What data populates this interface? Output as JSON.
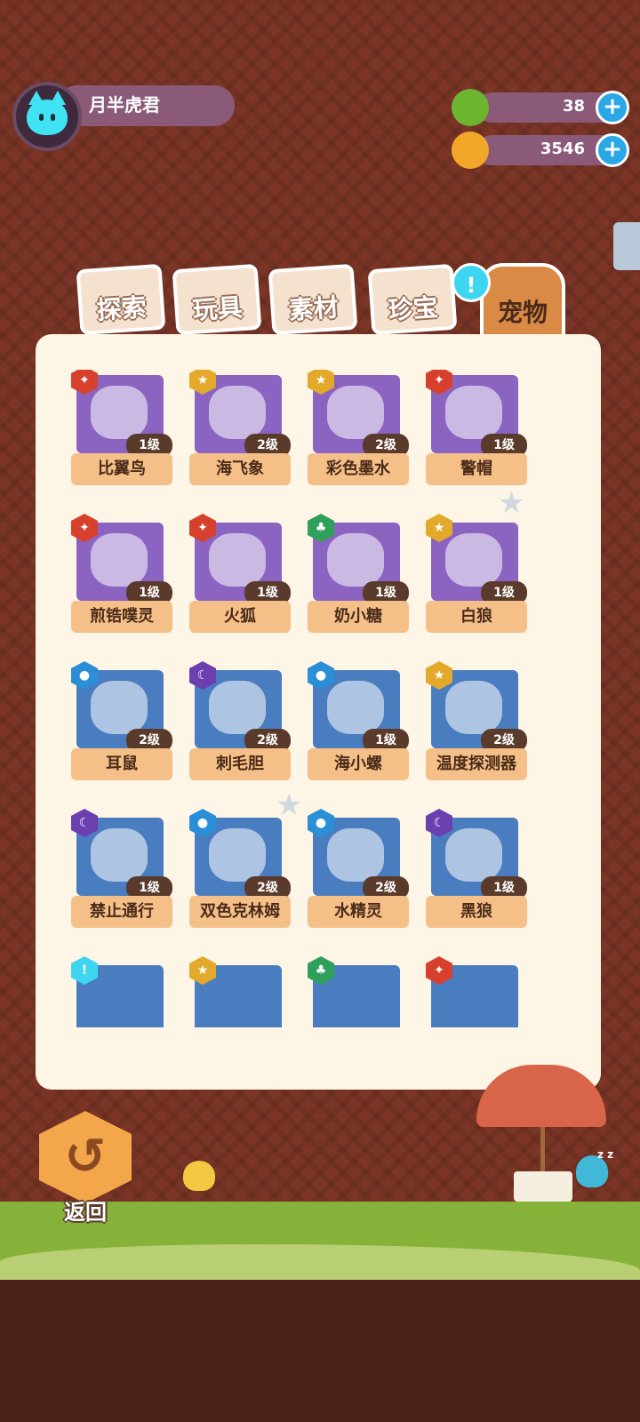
{
  "player": {
    "name": "月半虎君"
  },
  "currencies": [
    {
      "name": "gem",
      "value": "38",
      "color": "#6cb52f"
    },
    {
      "name": "coin",
      "value": "3546",
      "color": "#f2a72a"
    }
  ],
  "tabs": [
    {
      "label": "探索"
    },
    {
      "label": "玩具"
    },
    {
      "label": "素材"
    },
    {
      "label": "珍宝"
    },
    {
      "label": "宠物",
      "active": true
    }
  ],
  "tab_badge": "!",
  "pets": [
    {
      "name": "比翼鸟",
      "level": "1级",
      "element": "fire",
      "color": "#8a64c0"
    },
    {
      "name": "海飞象",
      "level": "2级",
      "element": "star",
      "color": "#8a64c0"
    },
    {
      "name": "彩色墨水",
      "level": "2级",
      "element": "star",
      "color": "#8a64c0"
    },
    {
      "name": "警帽",
      "level": "1级",
      "element": "fire",
      "color": "#8a64c0"
    },
    {
      "name": "煎锆噗灵",
      "level": "1级",
      "element": "fire",
      "color": "#8a64c0"
    },
    {
      "name": "火狐",
      "level": "1级",
      "element": "fire",
      "color": "#8a64c0"
    },
    {
      "name": "奶小糖",
      "level": "1级",
      "element": "leaf",
      "color": "#8a64c0"
    },
    {
      "name": "白狼",
      "level": "1级",
      "element": "star",
      "color": "#8a64c0"
    },
    {
      "name": "耳鼠",
      "level": "2级",
      "element": "water",
      "color": "#4a7dbf"
    },
    {
      "name": "刺毛胆",
      "level": "2级",
      "element": "moon",
      "color": "#4a7dbf"
    },
    {
      "name": "海小螺",
      "level": "1级",
      "element": "water",
      "color": "#4a7dbf"
    },
    {
      "name": "温度探测器",
      "level": "2级",
      "element": "star",
      "color": "#4a7dbf"
    },
    {
      "name": "禁止通行",
      "level": "1级",
      "element": "moon",
      "color": "#4a7dbf"
    },
    {
      "name": "双色克林姆",
      "level": "2级",
      "element": "water",
      "color": "#4a7dbf"
    },
    {
      "name": "水精灵",
      "level": "2级",
      "element": "water",
      "color": "#4a7dbf"
    },
    {
      "name": "黑狼",
      "level": "1级",
      "element": "moon",
      "color": "#4a7dbf"
    }
  ],
  "partial_row_elements": [
    "alert",
    "star",
    "leaf",
    "fire"
  ],
  "element_colors": {
    "fire": "#d8402e",
    "star": "#e3a92a",
    "leaf": "#2fa05a",
    "water": "#2a8fd6",
    "moon": "#6a3fb0",
    "alert": "#3dd6f0"
  },
  "back_button": {
    "label": "返回"
  },
  "sleep_text": "z z"
}
